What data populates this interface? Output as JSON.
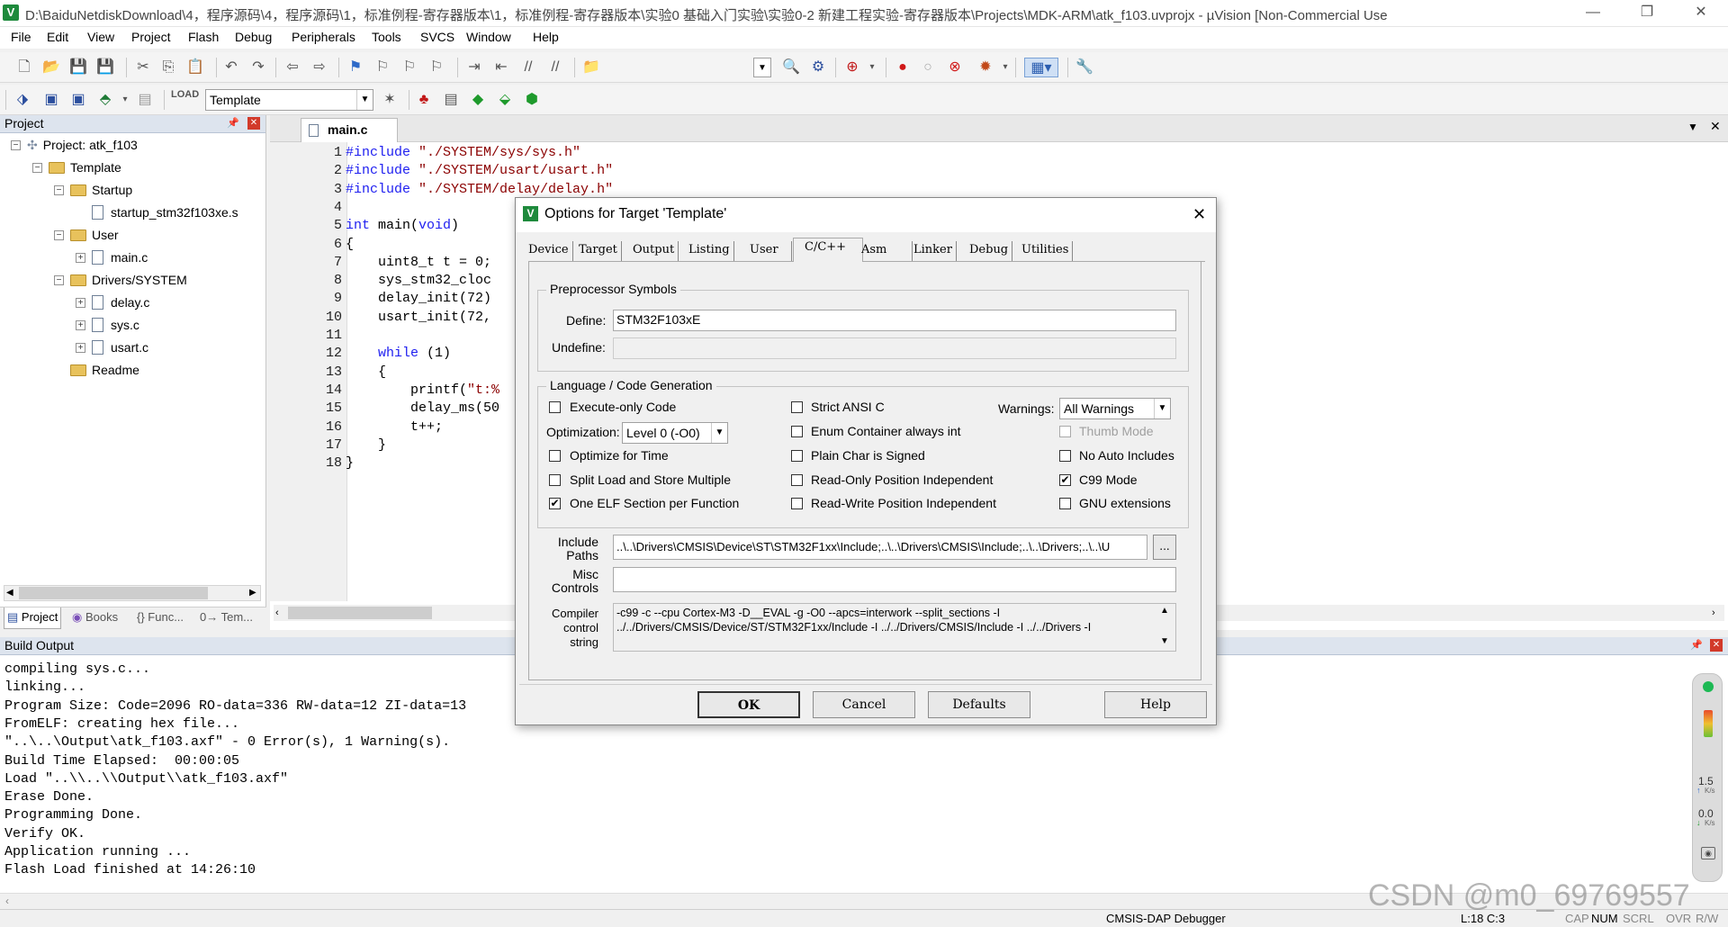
{
  "window": {
    "title": "D:\\BaiduNetdiskDownload\\4，程序源码\\4，程序源码\\1，标准例程-寄存器版本\\1，标准例程-寄存器版本\\实验0 基础入门实验\\实验0-2 新建工程实验-寄存器版本\\Projects\\MDK-ARM\\atk_f103.uvprojx - µVision  [Non-Commercial Use",
    "min": "—",
    "restore": "❐",
    "close": "✕"
  },
  "menu": [
    "File",
    "Edit",
    "View",
    "Project",
    "Flash",
    "Debug",
    "Peripherals",
    "Tools",
    "SVCS",
    "Window",
    "Help"
  ],
  "toolbar2": {
    "target_select": "Template"
  },
  "project_panel": {
    "title": "Project",
    "pin": "📌",
    "close": "✕",
    "tree": [
      {
        "label": "Project: atk_f103",
        "level": 0,
        "kind": "project",
        "expander": "−"
      },
      {
        "label": "Template",
        "level": 1,
        "kind": "target",
        "expander": "−"
      },
      {
        "label": "Startup",
        "level": 2,
        "kind": "folder",
        "expander": "−"
      },
      {
        "label": "startup_stm32f103xe.s",
        "level": 3,
        "kind": "file",
        "expander": ""
      },
      {
        "label": "User",
        "level": 2,
        "kind": "folder",
        "expander": "−"
      },
      {
        "label": "main.c",
        "level": 3,
        "kind": "file",
        "expander": "+"
      },
      {
        "label": "Drivers/SYSTEM",
        "level": 2,
        "kind": "folder",
        "expander": "−"
      },
      {
        "label": "delay.c",
        "level": 3,
        "kind": "file",
        "expander": "+"
      },
      {
        "label": "sys.c",
        "level": 3,
        "kind": "file",
        "expander": "+"
      },
      {
        "label": "usart.c",
        "level": 3,
        "kind": "file",
        "expander": "+"
      },
      {
        "label": "Readme",
        "level": 2,
        "kind": "folder",
        "expander": ""
      }
    ],
    "tabs": [
      "Project",
      "Books",
      "{} Func...",
      "0→ Tem..."
    ]
  },
  "editor": {
    "tab": "main.c",
    "lines": [
      {
        "n": "1",
        "code": "#include \"./SYSTEM/sys/sys.h\""
      },
      {
        "n": "2",
        "code": "#include \"./SYSTEM/usart/usart.h\""
      },
      {
        "n": "3",
        "code": "#include \"./SYSTEM/delay/delay.h\""
      },
      {
        "n": "4",
        "code": ""
      },
      {
        "n": "5",
        "code": "int main(void)"
      },
      {
        "n": "6",
        "code": "{"
      },
      {
        "n": "7",
        "code": "    uint8_t t = 0;"
      },
      {
        "n": "8",
        "code": "    sys_stm32_cloc"
      },
      {
        "n": "9",
        "code": "    delay_init(72)"
      },
      {
        "n": "10",
        "code": "    usart_init(72,"
      },
      {
        "n": "11",
        "code": ""
      },
      {
        "n": "12",
        "code": "    while (1)"
      },
      {
        "n": "13",
        "code": "    {"
      },
      {
        "n": "14",
        "code": "        printf(\"t:%"
      },
      {
        "n": "15",
        "code": "        delay_ms(50"
      },
      {
        "n": "16",
        "code": "        t++;"
      },
      {
        "n": "17",
        "code": "    }"
      },
      {
        "n": "18",
        "code": "}"
      }
    ]
  },
  "build_output": {
    "title": "Build Output",
    "lines": [
      "compiling sys.c...",
      "linking...",
      "Program Size: Code=2096 RO-data=336 RW-data=12 ZI-data=13",
      "FromELF: creating hex file...",
      "\"..\\..\\Output\\atk_f103.axf\" - 0 Error(s), 1 Warning(s).",
      "Build Time Elapsed:  00:00:05",
      "Load \"..\\\\..\\\\Output\\\\atk_f103.axf\"",
      "Erase Done.",
      "Programming Done.",
      "Verify OK.",
      "Application running ...",
      "Flash Load finished at 14:26:10"
    ]
  },
  "side_widget": {
    "up_rate": "1.5",
    "up_unit": "K/s",
    "down_rate": "0.0",
    "down_unit": "K/s"
  },
  "status_bar": {
    "debugger": "CMSIS-DAP Debugger",
    "position": "L:18 C:3",
    "indicators": [
      "CAP",
      "NUM",
      "SCRL",
      "OVR",
      "R/W"
    ]
  },
  "watermark": "CSDN @m0_69769557",
  "dialog": {
    "title": "Options for Target 'Template'",
    "close": "✕",
    "tabs": [
      "Device",
      "Target",
      "Output",
      "Listing",
      "User",
      "C/C++",
      "Asm",
      "Linker",
      "Debug",
      "Utilities"
    ],
    "active_tab": "C/C++",
    "preprocessor": {
      "group_label": "Preprocessor Symbols",
      "define_label": "Define:",
      "define_value": "STM32F103xE",
      "undefine_label": "Undefine:",
      "undefine_value": ""
    },
    "language": {
      "group_label": "Language / Code Generation",
      "execute_only": {
        "label": "Execute-only Code",
        "checked": false
      },
      "optimization_label": "Optimization:",
      "optimization_value": "Level 0 (-O0)",
      "optimize_time": {
        "label": "Optimize for Time",
        "checked": false
      },
      "split_load": {
        "label": "Split Load and Store Multiple",
        "checked": false
      },
      "one_elf": {
        "label": "One ELF Section per Function",
        "checked": true
      },
      "strict_ansi": {
        "label": "Strict ANSI C",
        "checked": false
      },
      "enum_container": {
        "label": "Enum Container always int",
        "checked": false
      },
      "plain_char": {
        "label": "Plain Char is Signed",
        "checked": false
      },
      "ro_pi": {
        "label": "Read-Only Position Independent",
        "checked": false
      },
      "rw_pi": {
        "label": "Read-Write Position Independent",
        "checked": false
      },
      "warnings_label": "Warnings:",
      "warnings_value": "All Warnings",
      "thumb_mode": {
        "label": "Thumb Mode",
        "checked": false,
        "disabled": true
      },
      "no_auto_includes": {
        "label": "No Auto Includes",
        "checked": false
      },
      "c99_mode": {
        "label": "C99 Mode",
        "checked": true
      },
      "gnu_ext": {
        "label": "GNU extensions",
        "checked": false
      }
    },
    "include_label_1": "Include",
    "include_label_2": "Paths",
    "include_value": "..\\..\\Drivers\\CMSIS\\Device\\ST\\STM32F1xx\\Include;..\\..\\Drivers\\CMSIS\\Include;..\\..\\Drivers;..\\..\\U",
    "include_browse": "...",
    "misc_label_1": "Misc",
    "misc_label_2": "Controls",
    "misc_value": "",
    "compiler_label_1": "Compiler",
    "compiler_label_2": "control",
    "compiler_label_3": "string",
    "compiler_line1": "-c99 -c --cpu Cortex-M3 -D__EVAL -g -O0 --apcs=interwork --split_sections -I",
    "compiler_line2": "../../Drivers/CMSIS/Device/ST/STM32F1xx/Include -I ../../Drivers/CMSIS/Include -I ../../Drivers -I",
    "buttons": {
      "ok": "OK",
      "cancel": "Cancel",
      "defaults": "Defaults",
      "help": "Help"
    }
  }
}
